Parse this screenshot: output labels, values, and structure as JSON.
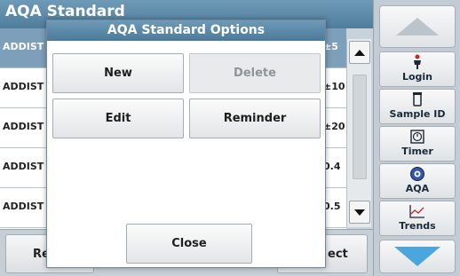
{
  "screen": {
    "title": "AQA Standard"
  },
  "list": {
    "rows": [
      {
        "name": "ADDIST",
        "value": "±5"
      },
      {
        "name": "ADDIST",
        "value": "±10"
      },
      {
        "name": "ADDIST",
        "value": "±20"
      },
      {
        "name": "ADDIST",
        "value": "0.4"
      },
      {
        "name": "ADDIST",
        "value": "0.5"
      }
    ]
  },
  "bottom_bar": {
    "left_label": "Re",
    "right_label": "ect"
  },
  "sidebar": {
    "login_label": "Login",
    "sample_id_label": "Sample ID",
    "timer_label": "Timer",
    "aqa_label": "AQA",
    "trends_label": "Trends"
  },
  "modal": {
    "title": "AQA Standard Options",
    "new_label": "New",
    "delete_label": "Delete",
    "edit_label": "Edit",
    "reminder_label": "Reminder",
    "close_label": "Close"
  },
  "colors": {
    "title_bar": "#5a87a6",
    "selected_row": "#7e9fb9",
    "nav_down_arrow": "#4aa6dc"
  }
}
